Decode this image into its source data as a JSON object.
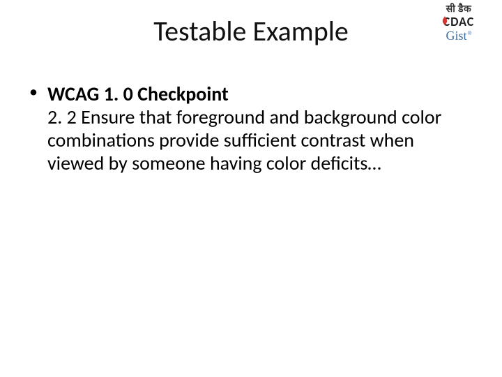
{
  "logo": {
    "hindi": "सी डैक",
    "cdac": "CDAC",
    "gist": "Gist",
    "reg": "®"
  },
  "title": "Testable Example",
  "bullet": {
    "heading": "WCAG 1. 0 Checkpoint",
    "text": "2. 2 Ensure that foreground and background color combinations provide sufficient contrast when viewed by someone having color deficits…"
  }
}
